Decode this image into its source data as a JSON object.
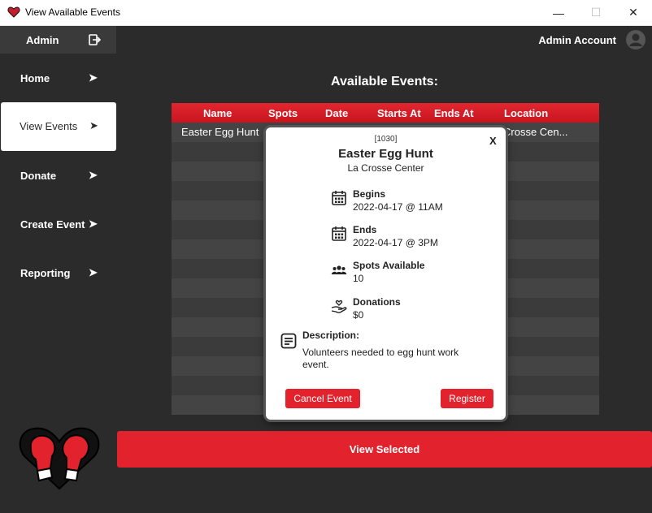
{
  "window": {
    "title": "View Available Events",
    "min_glyph": "—",
    "max_glyph": "☐",
    "close_glyph": "✕"
  },
  "sidebar": {
    "user": "Admin",
    "chevron": "➤",
    "items": [
      {
        "label": "Home"
      },
      {
        "label": "View Events"
      },
      {
        "label": "Donate"
      },
      {
        "label": "Create Event"
      },
      {
        "label": "Reporting"
      }
    ]
  },
  "header": {
    "account": "Admin Account"
  },
  "main": {
    "heading": "Available Events:",
    "columns": [
      "Name",
      "Spots",
      "Date",
      "Starts At",
      "Ends At",
      "Location"
    ],
    "rows": [
      {
        "name": "Easter Egg Hunt",
        "location": "Crosse Cen..."
      }
    ],
    "view_button": "View Selected"
  },
  "modal": {
    "id": "[1030]",
    "close": "X",
    "event_name": "Easter Egg Hunt",
    "location": "La Crosse Center",
    "begins_label": "Begins",
    "begins_value": "2022-04-17 @ 11AM",
    "ends_label": "Ends",
    "ends_value": "2022-04-17 @ 3PM",
    "spots_label": "Spots Available",
    "spots_value": "10",
    "donations_label": "Donations",
    "donations_value": "$0",
    "description_label": "Description:",
    "description_text": "Volunteers needed to egg hunt work event.",
    "cancel_button": "Cancel Event",
    "register_button": "Register"
  },
  "colors": {
    "accent": "#e2232d",
    "background": "#2b2b2b",
    "row_light": "#444444",
    "row_dark": "#3b3b3b"
  }
}
